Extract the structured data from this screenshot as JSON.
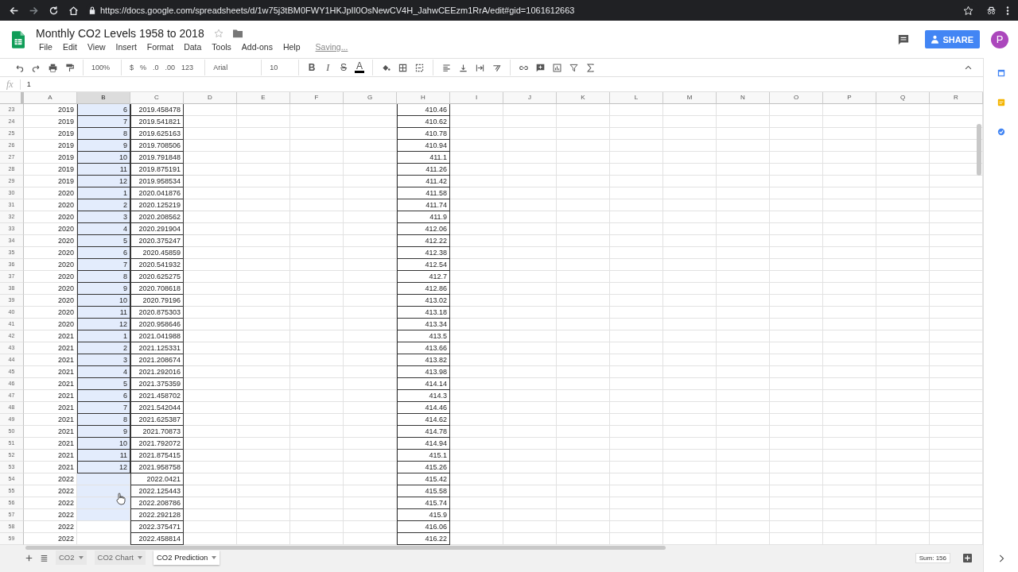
{
  "browser": {
    "url": "https://docs.google.com/spreadsheets/d/1w75j3tBM0FWY1HKJpII0OsNewCV4H_JahwCEEzm1RrA/edit#gid=1061612663"
  },
  "document": {
    "title": "Monthly CO2 Levels 1958 to 2018",
    "menu": [
      "File",
      "Edit",
      "View",
      "Insert",
      "Format",
      "Data",
      "Tools",
      "Add-ons",
      "Help"
    ],
    "save_status": "Saving...",
    "share": "SHARE",
    "avatar": "P"
  },
  "toolbar": {
    "zoom": "100%",
    "currency": "$",
    "percent": "%",
    "decrease_decimals": ".0",
    "increase_decimals": ".00",
    "number_format": "123",
    "font": "Arial",
    "font_size": "10",
    "bold": "B",
    "italic": "I",
    "strikethrough": "S",
    "text_color": "A"
  },
  "formula_bar": {
    "label": "fx",
    "value": "1"
  },
  "columns": [
    {
      "label": "A",
      "selected": false
    },
    {
      "label": "B",
      "selected": true
    },
    {
      "label": "C",
      "selected": false
    },
    {
      "label": "D",
      "selected": false
    },
    {
      "label": "E",
      "selected": false
    },
    {
      "label": "F",
      "selected": false
    },
    {
      "label": "G",
      "selected": false
    },
    {
      "label": "H",
      "selected": false
    },
    {
      "label": "I",
      "selected": false
    },
    {
      "label": "J",
      "selected": false
    },
    {
      "label": "K",
      "selected": false
    },
    {
      "label": "L",
      "selected": false
    },
    {
      "label": "M",
      "selected": false
    },
    {
      "label": "N",
      "selected": false
    },
    {
      "label": "O",
      "selected": false
    },
    {
      "label": "P",
      "selected": false
    },
    {
      "label": "Q",
      "selected": false
    },
    {
      "label": "R",
      "selected": false
    }
  ],
  "rows": [
    {
      "number": "23",
      "a": "2019",
      "b": "6",
      "c": "2019.458478",
      "h": "410.46",
      "selected": true
    },
    {
      "number": "24",
      "a": "2019",
      "b": "7",
      "c": "2019.541821",
      "h": "410.62",
      "selected": true
    },
    {
      "number": "25",
      "a": "2019",
      "b": "8",
      "c": "2019.625163",
      "h": "410.78",
      "selected": true
    },
    {
      "number": "26",
      "a": "2019",
      "b": "9",
      "c": "2019.708506",
      "h": "410.94",
      "selected": true
    },
    {
      "number": "27",
      "a": "2019",
      "b": "10",
      "c": "2019.791848",
      "h": "411.1",
      "selected": true
    },
    {
      "number": "28",
      "a": "2019",
      "b": "11",
      "c": "2019.875191",
      "h": "411.26",
      "selected": true
    },
    {
      "number": "29",
      "a": "2019",
      "b": "12",
      "c": "2019.958534",
      "h": "411.42",
      "selected": true
    },
    {
      "number": "30",
      "a": "2020",
      "b": "1",
      "c": "2020.041876",
      "h": "411.58",
      "selected": true
    },
    {
      "number": "31",
      "a": "2020",
      "b": "2",
      "c": "2020.125219",
      "h": "411.74",
      "selected": true
    },
    {
      "number": "32",
      "a": "2020",
      "b": "3",
      "c": "2020.208562",
      "h": "411.9",
      "selected": true
    },
    {
      "number": "33",
      "a": "2020",
      "b": "4",
      "c": "2020.291904",
      "h": "412.06",
      "selected": true
    },
    {
      "number": "34",
      "a": "2020",
      "b": "5",
      "c": "2020.375247",
      "h": "412.22",
      "selected": true
    },
    {
      "number": "35",
      "a": "2020",
      "b": "6",
      "c": "2020.45859",
      "h": "412.38",
      "selected": true
    },
    {
      "number": "36",
      "a": "2020",
      "b": "7",
      "c": "2020.541932",
      "h": "412.54",
      "selected": true
    },
    {
      "number": "37",
      "a": "2020",
      "b": "8",
      "c": "2020.625275",
      "h": "412.7",
      "selected": true
    },
    {
      "number": "38",
      "a": "2020",
      "b": "9",
      "c": "2020.708618",
      "h": "412.86",
      "selected": true
    },
    {
      "number": "39",
      "a": "2020",
      "b": "10",
      "c": "2020.79196",
      "h": "413.02",
      "selected": true
    },
    {
      "number": "40",
      "a": "2020",
      "b": "11",
      "c": "2020.875303",
      "h": "413.18",
      "selected": true
    },
    {
      "number": "41",
      "a": "2020",
      "b": "12",
      "c": "2020.958646",
      "h": "413.34",
      "selected": true
    },
    {
      "number": "42",
      "a": "2021",
      "b": "1",
      "c": "2021.041988",
      "h": "413.5",
      "selected": true
    },
    {
      "number": "43",
      "a": "2021",
      "b": "2",
      "c": "2021.125331",
      "h": "413.66",
      "selected": true
    },
    {
      "number": "44",
      "a": "2021",
      "b": "3",
      "c": "2021.208674",
      "h": "413.82",
      "selected": true
    },
    {
      "number": "45",
      "a": "2021",
      "b": "4",
      "c": "2021.292016",
      "h": "413.98",
      "selected": true
    },
    {
      "number": "46",
      "a": "2021",
      "b": "5",
      "c": "2021.375359",
      "h": "414.14",
      "selected": true
    },
    {
      "number": "47",
      "a": "2021",
      "b": "6",
      "c": "2021.458702",
      "h": "414.3",
      "selected": true
    },
    {
      "number": "48",
      "a": "2021",
      "b": "7",
      "c": "2021.542044",
      "h": "414.46",
      "selected": true
    },
    {
      "number": "49",
      "a": "2021",
      "b": "8",
      "c": "2021.625387",
      "h": "414.62",
      "selected": true
    },
    {
      "number": "50",
      "a": "2021",
      "b": "9",
      "c": "2021.70873",
      "h": "414.78",
      "selected": true
    },
    {
      "number": "51",
      "a": "2021",
      "b": "10",
      "c": "2021.792072",
      "h": "414.94",
      "selected": true
    },
    {
      "number": "52",
      "a": "2021",
      "b": "11",
      "c": "2021.875415",
      "h": "415.1",
      "selected": true
    },
    {
      "number": "53",
      "a": "2021",
      "b": "12",
      "c": "2021.958758",
      "h": "415.26",
      "selected": true
    },
    {
      "number": "54",
      "a": "2022",
      "c": "2022.0421",
      "h": "415.42",
      "selected": true
    },
    {
      "number": "55",
      "a": "2022",
      "c": "2022.125443",
      "h": "415.58",
      "selected": true
    },
    {
      "number": "56",
      "a": "2022",
      "c": "2022.208786",
      "h": "415.74",
      "selected": true
    },
    {
      "number": "57",
      "a": "2022",
      "c": "2022.292128",
      "h": "415.9",
      "selected": true
    },
    {
      "number": "58",
      "a": "2022",
      "c": "2022.375471",
      "h": "416.06",
      "selected": false
    },
    {
      "number": "59",
      "a": "2022",
      "c": "2022.458814",
      "h": "416.22",
      "selected": false
    }
  ],
  "sheets": [
    {
      "name": "CO2",
      "selected": false
    },
    {
      "name": "CO2 Chart",
      "selected": false
    },
    {
      "name": "CO2 Prediction",
      "selected": true
    }
  ],
  "sum": "Sum: 156"
}
